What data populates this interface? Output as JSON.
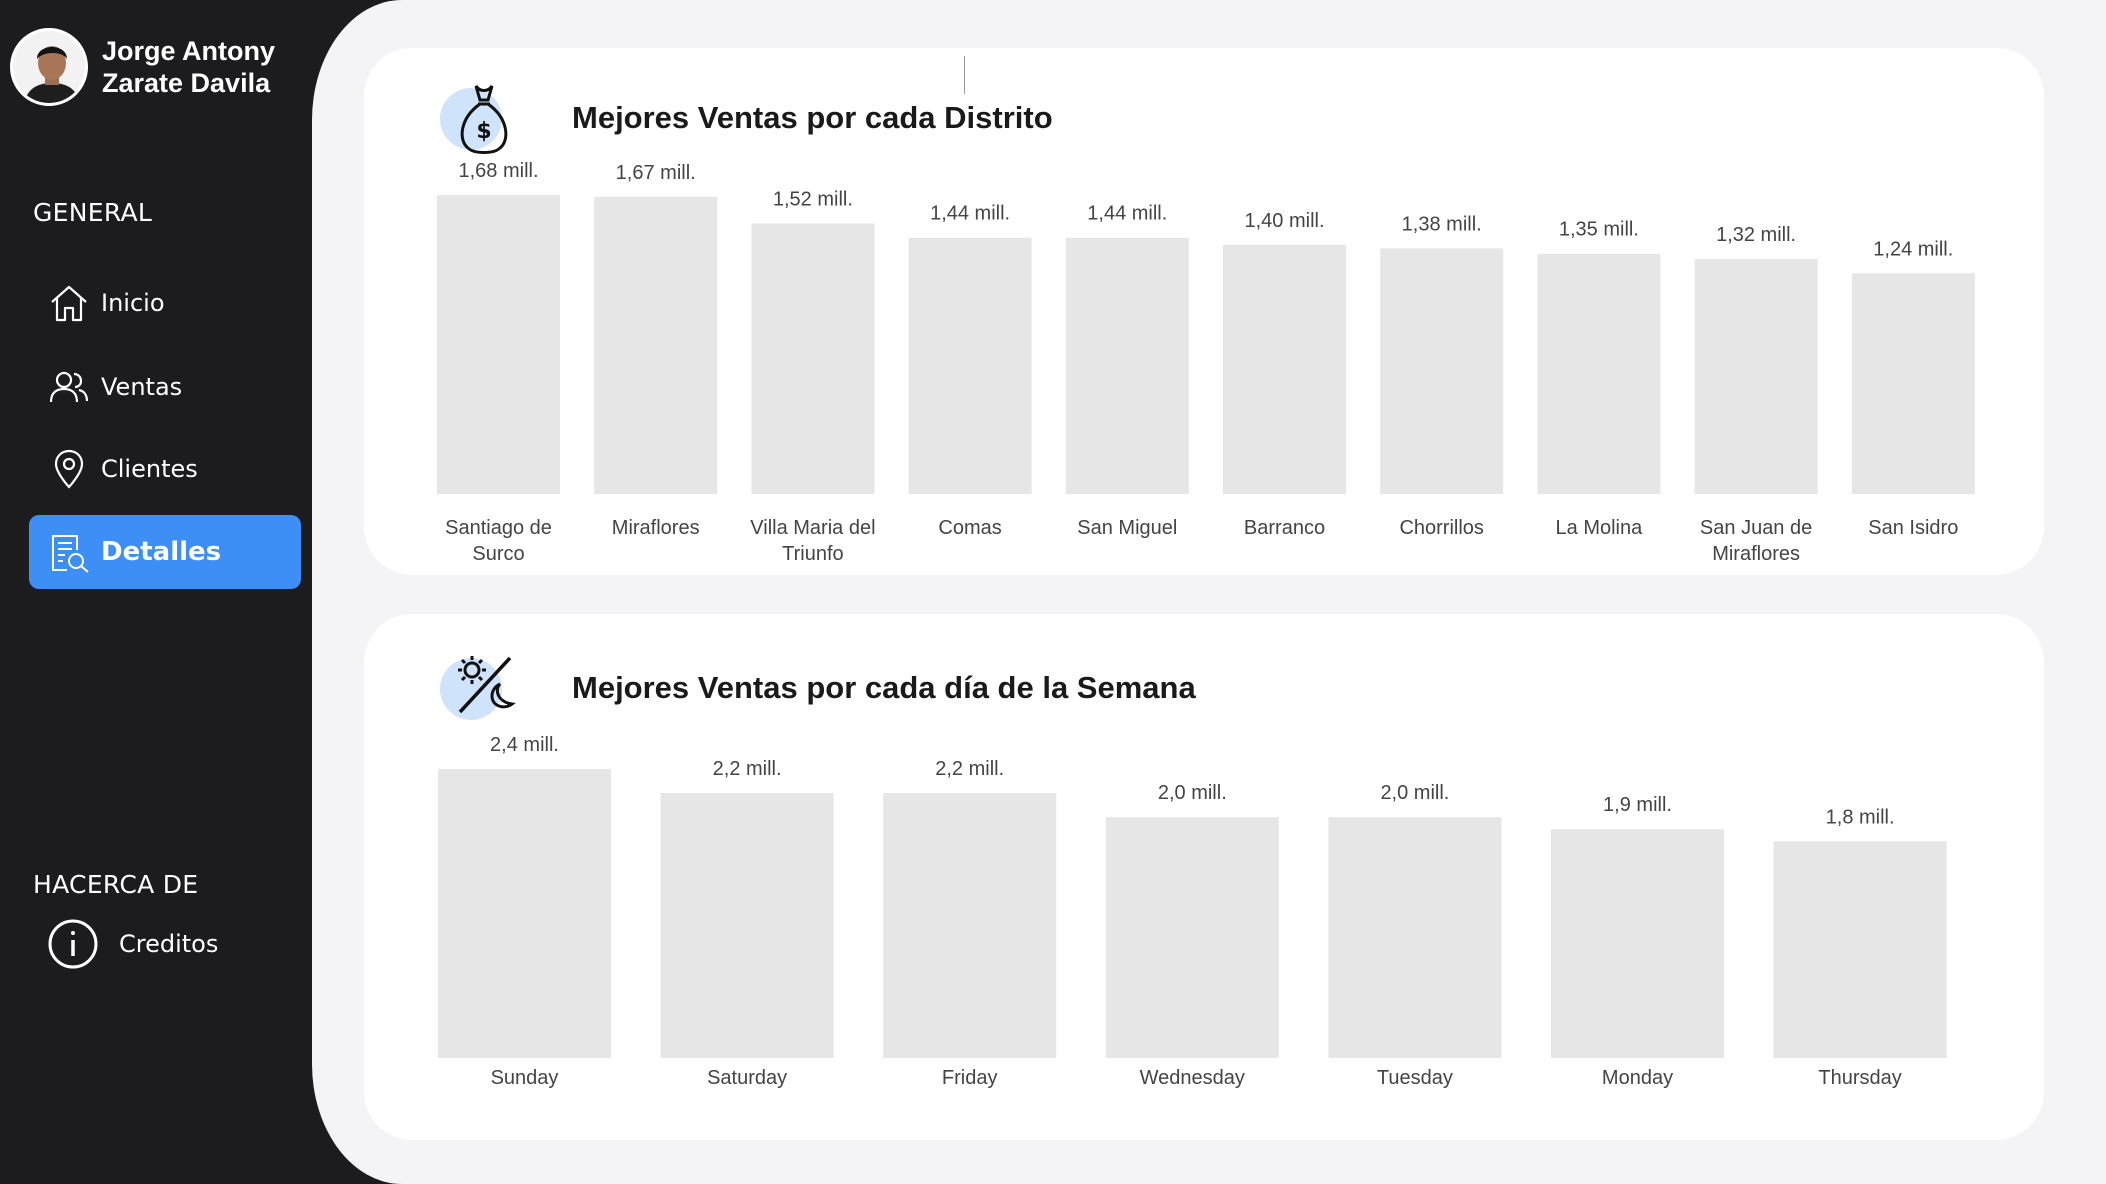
{
  "profile": {
    "name_line1": "Jorge Antony",
    "name_line2": "Zarate Davila"
  },
  "sidebar": {
    "section_general": "GENERAL",
    "items": [
      {
        "label": "Inicio",
        "icon": "home-icon"
      },
      {
        "label": "Ventas",
        "icon": "users-icon"
      },
      {
        "label": "Clientes",
        "icon": "map-pin-icon"
      },
      {
        "label": "Detalles",
        "icon": "document-search-icon",
        "active": true
      }
    ],
    "section_about": "HACERCA DE",
    "about_items": [
      {
        "label": "Creditos",
        "icon": "info-icon"
      }
    ]
  },
  "colors": {
    "sidebar_bg": "#1c1c1e",
    "accent": "#3d8ef5",
    "bar": "#e6e6e6",
    "icon_blob": "#cfe3fb",
    "page_bg": "#f4f4f6"
  },
  "chart_data": [
    {
      "type": "bar",
      "title": "Mejores Ventas por cada Distrito",
      "icon": "money-bag-icon",
      "categories": [
        [
          "Santiago de",
          "Surco"
        ],
        [
          "Miraflores"
        ],
        [
          "Villa Maria del",
          "Triunfo"
        ],
        [
          "Comas"
        ],
        [
          "San Miguel"
        ],
        [
          "Barranco"
        ],
        [
          "Chorrillos"
        ],
        [
          "La Molina"
        ],
        [
          "San Juan de",
          "Miraflores"
        ],
        [
          "San Isidro"
        ]
      ],
      "values": [
        1.68,
        1.67,
        1.52,
        1.44,
        1.44,
        1.4,
        1.38,
        1.35,
        1.32,
        1.24
      ],
      "data_labels": [
        "1,68 mill.",
        "1,67 mill.",
        "1,52 mill.",
        "1,44 mill.",
        "1,44 mill.",
        "1,40 mill.",
        "1,38 mill.",
        "1,35 mill.",
        "1,32 mill.",
        "1,24 mill."
      ],
      "xlabel": "",
      "ylabel": "",
      "ylim": [
        0,
        1.68
      ],
      "grid": false
    },
    {
      "type": "bar",
      "title": "Mejores Ventas por cada día de la Semana",
      "icon": "day-night-icon",
      "categories": [
        [
          "Sunday"
        ],
        [
          "Saturday"
        ],
        [
          "Friday"
        ],
        [
          "Wednesday"
        ],
        [
          "Tuesday"
        ],
        [
          "Monday"
        ],
        [
          "Thursday"
        ]
      ],
      "values": [
        2.4,
        2.2,
        2.2,
        2.0,
        2.0,
        1.9,
        1.8
      ],
      "data_labels": [
        "2,4 mill.",
        "2,2 mill.",
        "2,2 mill.",
        "2,0 mill.",
        "2,0 mill.",
        "1,9 mill.",
        "1,8 mill."
      ],
      "xlabel": "",
      "ylabel": "",
      "ylim": [
        0,
        2.4
      ],
      "grid": false
    }
  ]
}
